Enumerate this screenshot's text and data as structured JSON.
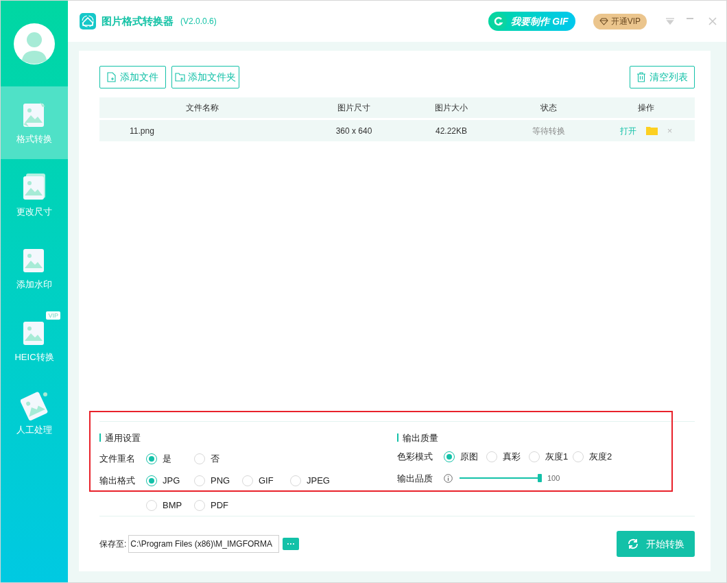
{
  "window": {
    "title": "图片格式转换器",
    "version": "(V2.0.0.6)"
  },
  "header": {
    "gif_button": "我要制作 GIF",
    "vip_button": "开通VIP"
  },
  "sidebar": {
    "items": [
      {
        "label": "格式转换",
        "selected": true
      },
      {
        "label": "更改尺寸",
        "selected": false
      },
      {
        "label": "添加水印",
        "selected": false
      },
      {
        "label": "HEIC转换",
        "selected": false,
        "badge": "VIP"
      },
      {
        "label": "人工处理",
        "selected": false
      }
    ]
  },
  "toolbar": {
    "add_file": "添加文件",
    "add_folder": "添加文件夹",
    "clear_list": "清空列表"
  },
  "table": {
    "columns": [
      "文件名称",
      "图片尺寸",
      "图片大小",
      "状态",
      "操作"
    ],
    "rows": [
      {
        "name": "11.png",
        "dimensions": "360 x 640",
        "size": "42.22KB",
        "status": "等待转换",
        "open": "打开",
        "delete": "×"
      }
    ]
  },
  "general_settings": {
    "title": "通用设置",
    "rows": [
      {
        "label": "文件重名",
        "options": [
          {
            "label": "是",
            "selected": true
          },
          {
            "label": "否",
            "selected": false
          }
        ]
      },
      {
        "label": "输出格式",
        "options": [
          {
            "label": "JPG",
            "selected": true
          },
          {
            "label": "PNG",
            "selected": false
          },
          {
            "label": "GIF",
            "selected": false
          },
          {
            "label": "JPEG",
            "selected": false
          },
          {
            "label": "BMP",
            "selected": false
          },
          {
            "label": "PDF",
            "selected": false
          }
        ]
      }
    ]
  },
  "quality_settings": {
    "title": "输出质量",
    "color_mode": {
      "label": "色彩模式",
      "options": [
        {
          "label": "原图",
          "selected": true
        },
        {
          "label": "真彩",
          "selected": false
        },
        {
          "label": "灰度1",
          "selected": false
        },
        {
          "label": "灰度2",
          "selected": false
        }
      ]
    },
    "quality": {
      "label": "输出品质",
      "level": 1,
      "reading": "100"
    }
  },
  "save": {
    "label": "保存至:",
    "path": "C:\\Program Files (x86)\\M_IMGFORMA",
    "browse": "···",
    "start": "开始转换"
  }
}
